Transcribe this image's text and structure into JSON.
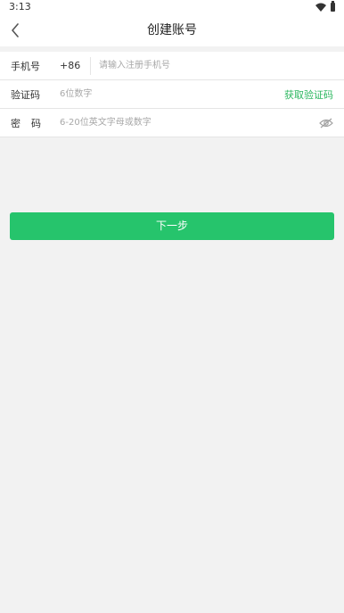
{
  "status_bar": {
    "time": "3:13",
    "wifi_icon": "wifi-icon",
    "battery_icon": "battery-icon"
  },
  "nav": {
    "title": "创建账号",
    "back_icon": "chevron-left-icon"
  },
  "form": {
    "phone": {
      "label": "手机号",
      "country_code": "+86",
      "value": "",
      "placeholder": "请输入注册手机号"
    },
    "code": {
      "label": "验证码",
      "value": "",
      "placeholder": "6位数字",
      "action_label": "获取验证码"
    },
    "password": {
      "label": "密码",
      "value": "",
      "placeholder": "6-20位英文字母或数字",
      "toggle_icon": "eye-off-icon"
    }
  },
  "next_button": {
    "label": "下一步"
  },
  "colors": {
    "accent": "#26c46c",
    "accent_text": "#2bb75f",
    "background": "#f2f2f2"
  }
}
